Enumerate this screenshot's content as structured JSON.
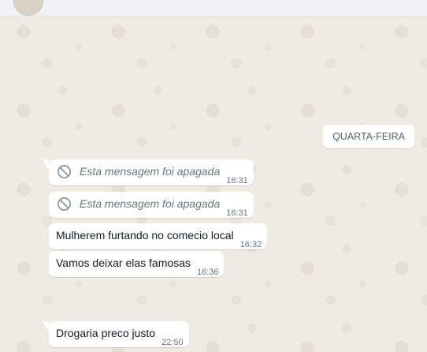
{
  "day_divider": "QUARTA-FEIRA",
  "messages": [
    {
      "text": "Esta mensagem foi apagada",
      "time": "16:31",
      "deleted": true
    },
    {
      "text": "Esta mensagem foi apagada",
      "time": "16:31",
      "deleted": true
    },
    {
      "text": "Mulherem furtando no comecio local",
      "time": "16:32",
      "deleted": false
    },
    {
      "text": "Vamos deixar elas famosas",
      "time": "16:36",
      "deleted": false
    },
    {
      "text": "Drogaria preco justo",
      "time": "22:50",
      "deleted": false
    }
  ],
  "icons": {
    "deleted": "ban-icon"
  },
  "colors": {
    "chat_background": "#efeae2",
    "bubble_incoming": "#ffffff",
    "meta_text": "#667781"
  }
}
